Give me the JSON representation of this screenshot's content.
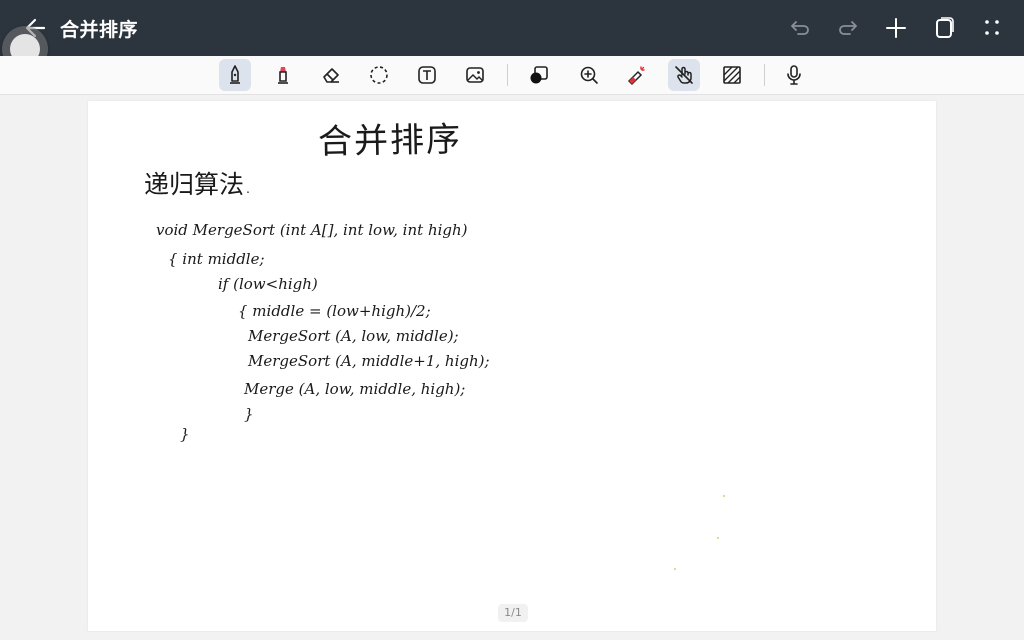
{
  "header": {
    "title": "合并排序",
    "icons": [
      "back-arrow-icon",
      "undo-icon",
      "redo-icon",
      "plus-icon",
      "copy-pages-icon",
      "more-dots-icon"
    ],
    "header_bg": "#2c343d"
  },
  "toolbar": {
    "tools": [
      "pen",
      "highlighter",
      "eraser",
      "lasso",
      "text",
      "image",
      "shapes",
      "zoom",
      "laser-pointer",
      "finger-draw",
      "pattern",
      "microphone"
    ],
    "active_tools": [
      "pen",
      "finger-draw"
    ],
    "active_bg": "#dde3ec"
  },
  "canvas": {
    "title": "合并排序",
    "subtitle": "递归算法.",
    "code_lines": [
      "void MergeSort (int A[], int low, int high)",
      "{  int middle;",
      "if (low<high)",
      "{ middle = (low+high)/2;",
      "MergeSort (A, low, middle);",
      "MergeSort (A, middle+1, high);",
      "Merge (A, low, middle, high);",
      "}",
      "}"
    ],
    "page_number": "1/1"
  }
}
